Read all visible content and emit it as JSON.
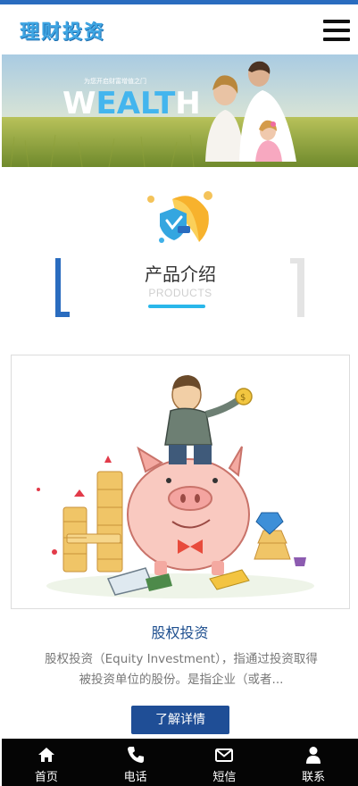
{
  "header": {
    "logo_text": "理财投资",
    "menu_icon": "hamburger-menu-icon"
  },
  "banner": {
    "headline_prefix": "W",
    "headline_accent": "EALT",
    "headline_suffix": "H",
    "tagline": "为您开启财富增值之门"
  },
  "section": {
    "title": "产品介绍",
    "subtitle": "PRODUCTS",
    "icon": "umbrella-shield-icon"
  },
  "product": {
    "name": "股权投资",
    "description": "股权投资（Equity Investment），指通过投资取得被投资单位的股份。是指企业（或者...",
    "button_label": "了解详情",
    "image": "piggy-bank-investment-illustration"
  },
  "bottom_nav": {
    "items": [
      {
        "label": "首页",
        "icon": "home-icon"
      },
      {
        "label": "电话",
        "icon": "phone-icon"
      },
      {
        "label": "短信",
        "icon": "envelope-icon"
      },
      {
        "label": "联系",
        "icon": "user-icon"
      }
    ]
  },
  "colors": {
    "brand_blue": "#2a6cbf",
    "accent_cyan": "#29b7ea",
    "button_blue": "#1f4e96",
    "nav_bg": "#050505"
  }
}
